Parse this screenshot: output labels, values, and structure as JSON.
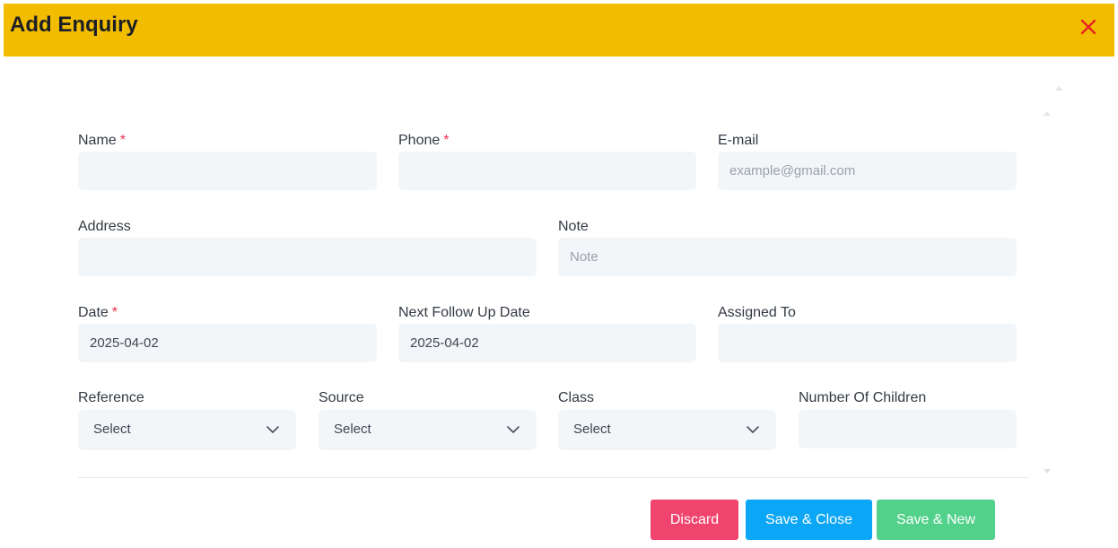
{
  "dialog": {
    "title": "Add Enquiry",
    "accent_color": "#f2bd00",
    "close_icon": "close-icon"
  },
  "form": {
    "name": {
      "label": "Name",
      "required_mark": "*",
      "value": ""
    },
    "phone": {
      "label": "Phone",
      "required_mark": "*",
      "value": ""
    },
    "email": {
      "label": "E-mail",
      "placeholder": "example@gmail.com",
      "value": ""
    },
    "address": {
      "label": "Address",
      "value": ""
    },
    "note": {
      "label": "Note",
      "placeholder": "Note",
      "value": ""
    },
    "date": {
      "label": "Date",
      "required_mark": "*",
      "value": "2025-04-02"
    },
    "next_follow_up_date": {
      "label": "Next Follow Up Date",
      "value": "2025-04-02"
    },
    "assigned_to": {
      "label": "Assigned To",
      "value": ""
    },
    "reference": {
      "label": "Reference",
      "selected": "Select"
    },
    "source": {
      "label": "Source",
      "selected": "Select"
    },
    "class": {
      "label": "Class",
      "selected": "Select"
    },
    "number_of_children": {
      "label": "Number Of Children",
      "value": ""
    }
  },
  "actions": {
    "discard": {
      "label": "Discard",
      "color": "#f0436d"
    },
    "save_close": {
      "label": "Save & Close",
      "color": "#0ba6f5"
    },
    "save_new": {
      "label": "Save & New",
      "color": "#52d18a"
    }
  }
}
